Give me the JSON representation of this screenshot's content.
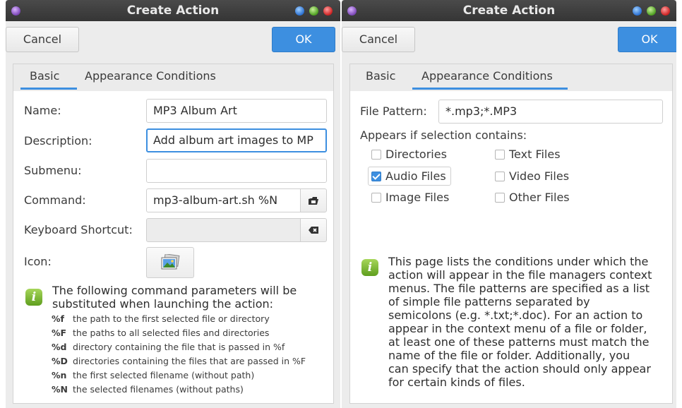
{
  "left_window": {
    "title": "Create Action",
    "cancel_label": "Cancel",
    "ok_label": "OK",
    "tabs": [
      {
        "label": "Basic"
      },
      {
        "label": "Appearance Conditions"
      }
    ],
    "active_tab": "Basic",
    "fields": {
      "name_label": "Name:",
      "name_value": "MP3 Album Art",
      "description_label": "Description:",
      "description_value": "Add album art images to MP",
      "submenu_label": "Submenu:",
      "submenu_value": "",
      "command_label": "Command:",
      "command_value": "mp3-album-art.sh %N",
      "shortcut_label": "Keyboard Shortcut:",
      "shortcut_value": "",
      "icon_label": "Icon:"
    },
    "info_line1": "The following command parameters will be",
    "info_line2": "substituted when launching the action:",
    "params": [
      {
        "code": "%f",
        "desc": "the path to the first selected file or directory"
      },
      {
        "code": "%F",
        "desc": "the paths to all selected files and directories"
      },
      {
        "code": "%d",
        "desc": "directory containing the file that is passed in %f"
      },
      {
        "code": "%D",
        "desc": "directories containing the files that are passed in %F"
      },
      {
        "code": "%n",
        "desc": "the first selected filename (without path)"
      },
      {
        "code": "%N",
        "desc": "the selected filenames (without paths)"
      }
    ]
  },
  "right_window": {
    "title": "Create Action",
    "cancel_label": "Cancel",
    "ok_label": "OK",
    "tabs": [
      {
        "label": "Basic"
      },
      {
        "label": "Appearance Conditions"
      }
    ],
    "active_tab": "Appearance Conditions",
    "file_pattern_label": "File Pattern:",
    "file_pattern_value": "*.mp3;*.MP3",
    "appears_label": "Appears if selection contains:",
    "checkboxes": [
      {
        "label": "Directories",
        "checked": false
      },
      {
        "label": "Text Files",
        "checked": false
      },
      {
        "label": "Audio Files",
        "checked": true
      },
      {
        "label": "Video Files",
        "checked": false
      },
      {
        "label": "Image Files",
        "checked": false
      },
      {
        "label": "Other Files",
        "checked": false
      }
    ],
    "info_lines": [
      "This page lists the conditions under which the",
      "action will appear in the file managers context",
      "menus. The file patterns are specified as a list",
      "of simple file patterns separated by",
      "semicolons (e.g. *.txt;*.doc). For an action to",
      "appear in the context menu of a file or folder,",
      "at least one of these patterns must match the",
      "name of the file or folder. Additionally, you",
      "can specify that the action should only appear",
      "for certain kinds of files."
    ]
  },
  "colors": {
    "accent": "#3d8fe0",
    "titlebar": "#3c3c3c",
    "dialog_bg": "#ececec",
    "info_green": "#7cbf3a"
  }
}
